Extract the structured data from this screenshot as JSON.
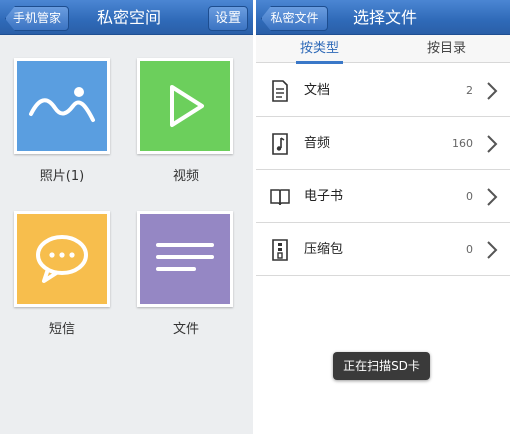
{
  "left_screen": {
    "back_label": "手机管家",
    "title": "私密空间",
    "settings_label": "设置",
    "tiles": [
      {
        "label": "照片(1)",
        "icon": "photo-icon",
        "color": "#5a9ee0"
      },
      {
        "label": "视频",
        "icon": "play-icon",
        "color": "#6ccf5c"
      },
      {
        "label": "短信",
        "icon": "message-icon",
        "color": "#f7be4d"
      },
      {
        "label": "文件",
        "icon": "file-lines-icon",
        "color": "#9587c4"
      }
    ]
  },
  "right_screen": {
    "back_label": "私密文件",
    "title": "选择文件",
    "tabs": [
      {
        "label": "按类型",
        "active": true
      },
      {
        "label": "按目录",
        "active": false
      }
    ],
    "rows": [
      {
        "label": "文档",
        "count": "2",
        "icon": "document-icon"
      },
      {
        "label": "音频",
        "count": "160",
        "icon": "music-note-icon"
      },
      {
        "label": "电子书",
        "count": "0",
        "icon": "book-icon"
      },
      {
        "label": "压缩包",
        "count": "0",
        "icon": "zip-icon"
      }
    ],
    "toast": "正在扫描SD卡"
  },
  "colors": {
    "titlebar": "#2f6ab8",
    "active_tab": "#3a78c8",
    "photo": "#5a9ee0",
    "video": "#6ccf5c",
    "sms": "#f7be4d",
    "file": "#9587c4"
  }
}
